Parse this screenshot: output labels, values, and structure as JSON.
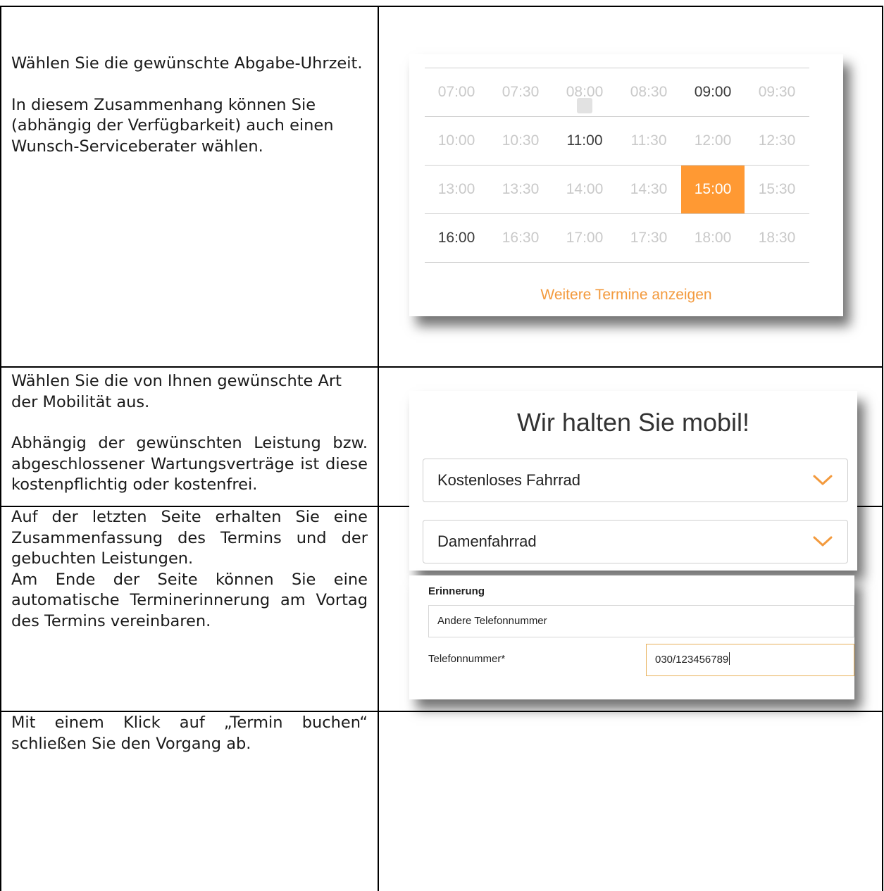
{
  "row1": {
    "description": [
      "Wählen Sie die gewünschte Abgabe-Uhrzeit.",
      "In diesem Zusammenhang können Sie (abhängig der Verfügbarkeit) auch einen Wunsch-Serviceberater wählen."
    ],
    "time_slots": [
      [
        "07:00",
        "07:30",
        "08:00",
        "08:30",
        "09:00",
        "09:30"
      ],
      [
        "10:00",
        "10:30",
        "11:00",
        "11:30",
        "12:00",
        "12:30"
      ],
      [
        "13:00",
        "13:30",
        "14:00",
        "14:30",
        "15:00",
        "15:30"
      ],
      [
        "16:00",
        "16:30",
        "17:00",
        "17:30",
        "18:00",
        "18:30"
      ]
    ],
    "available_slots": [
      "09:00",
      "11:00",
      "16:00"
    ],
    "selected_slot": "15:00",
    "more_link": "Weitere Termine anzeigen",
    "accent_color": "#ff9933"
  },
  "row2": {
    "description": [
      "Wählen Sie die von Ihnen gewünschte Art der Mobilität aus.",
      "Abhängig der gewünschten Leistung bzw. abgeschlossener Wartungsverträge ist diese kostenpflichtig oder kostenfrei."
    ],
    "title": "Wir halten Sie mobil!",
    "select1_value": "Kostenloses Fahrrad",
    "select2_value": "Damenfahrrad"
  },
  "row3": {
    "description": [
      "Auf der letzten Seite erhalten Sie eine Zusammenfassung des Termins und der gebuchten Leistungen.",
      "Am Ende der Seite können Sie eine automatische Terminerinnerung am Vortag des Termins vereinbaren."
    ],
    "heading": "Erinnerung",
    "option_value": "Andere Telefonnummer",
    "phone_label": "Telefonnummer*",
    "phone_value": "030/123456789"
  },
  "row4": {
    "description": "Mit einem Klick auf „Termin buchen“ schließen Sie den Vorgang ab."
  }
}
